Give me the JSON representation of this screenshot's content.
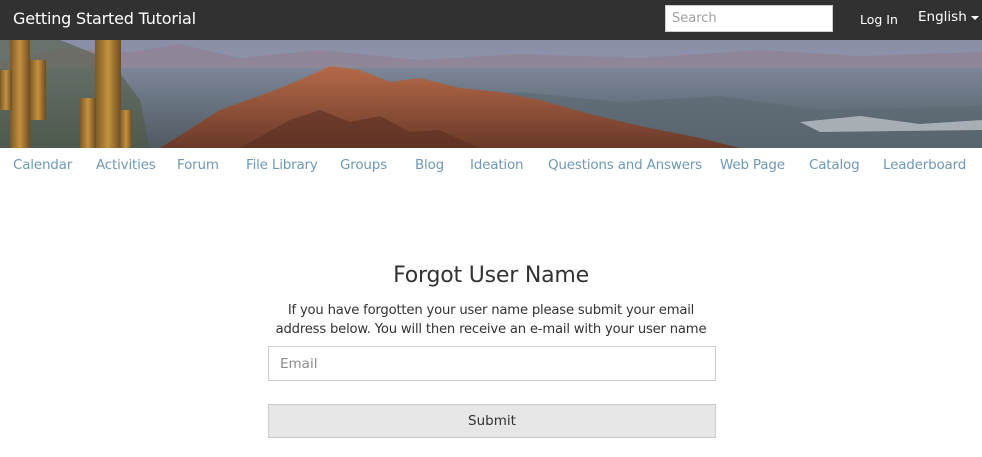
{
  "header": {
    "site_title": "Getting Started Tutorial",
    "search_placeholder": "Search",
    "login_label": "Log In",
    "language_label": "English",
    "background_color": "#313131"
  },
  "nav": {
    "items": [
      {
        "label": "Calendar"
      },
      {
        "label": "Activities"
      },
      {
        "label": "Forum"
      },
      {
        "label": "File Library"
      },
      {
        "label": "Groups"
      },
      {
        "label": "Blog"
      },
      {
        "label": "Ideation"
      },
      {
        "label": "Questions and Answers"
      },
      {
        "label": "Web Page"
      },
      {
        "label": "Catalog"
      },
      {
        "label": "Leaderboard"
      }
    ],
    "link_color": "#6f98b5"
  },
  "form": {
    "title": "Forgot User Name",
    "description_line1": "If you have forgotten your user name please submit your email",
    "description_line2": "address below. You will then receive an e-mail with your user name",
    "email_placeholder": "Email",
    "submit_label": "Submit"
  }
}
